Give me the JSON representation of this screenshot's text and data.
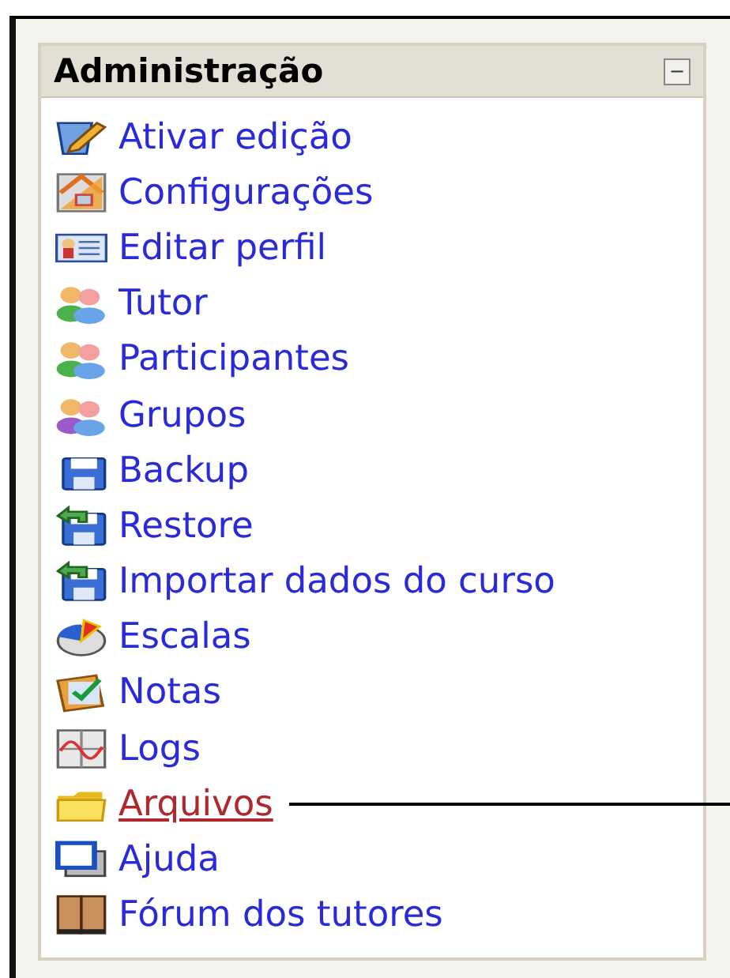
{
  "block": {
    "title": "Administração",
    "collapse_button": "−",
    "items": [
      {
        "label": "Ativar edição",
        "kind": "edit",
        "selected": false
      },
      {
        "label": "Configurações",
        "kind": "settings",
        "selected": false
      },
      {
        "label": "Editar perfil",
        "kind": "profile",
        "selected": false
      },
      {
        "label": "Tutor",
        "kind": "people",
        "selected": false
      },
      {
        "label": "Participantes",
        "kind": "people",
        "selected": false
      },
      {
        "label": "Grupos",
        "kind": "group",
        "selected": false
      },
      {
        "label": "Backup",
        "kind": "backup",
        "selected": false
      },
      {
        "label": "Restore",
        "kind": "restore",
        "selected": false
      },
      {
        "label": "Importar dados do curso",
        "kind": "restore",
        "selected": false
      },
      {
        "label": "Escalas",
        "kind": "scales",
        "selected": false
      },
      {
        "label": "Notas",
        "kind": "grades",
        "selected": false
      },
      {
        "label": "Logs",
        "kind": "logs",
        "selected": false
      },
      {
        "label": "Arquivos",
        "kind": "folder",
        "selected": true
      },
      {
        "label": "Ajuda",
        "kind": "help",
        "selected": false
      },
      {
        "label": "Fórum dos tutores",
        "kind": "forum",
        "selected": false
      }
    ]
  }
}
